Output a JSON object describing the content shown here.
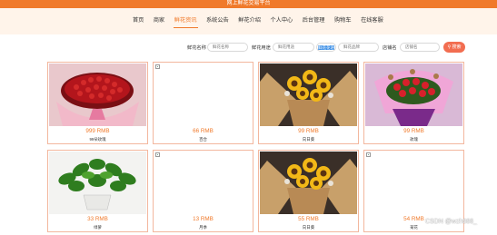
{
  "app": {
    "title": "网上鲜花交易平台"
  },
  "nav": {
    "items": [
      {
        "label": "首页"
      },
      {
        "label": "商家"
      },
      {
        "label": "鲜花资讯",
        "active": true
      },
      {
        "label": "系统公告"
      },
      {
        "label": "鲜花介绍"
      },
      {
        "label": "个人中心"
      },
      {
        "label": "后台管理"
      },
      {
        "label": "购物车"
      },
      {
        "label": "在线客服"
      }
    ]
  },
  "search": {
    "fields": [
      {
        "label": "鲜花名称",
        "placeholder": "鲜花名称"
      },
      {
        "label": "鲜花用途",
        "placeholder": "鲜花用途"
      },
      {
        "label": "",
        "value": "鲜花花语"
      },
      {
        "label": "",
        "placeholder": "鲜花品牌"
      },
      {
        "label": "店铺名",
        "placeholder": "店铺名"
      }
    ],
    "button_label": "搜索",
    "button_icon": "search-icon"
  },
  "products": [
    {
      "price": "999 RMB",
      "name": "99朵玫瑰",
      "image": "red-roses-bouquet"
    },
    {
      "price": "66 RMB",
      "name": "百合",
      "image": "broken-image"
    },
    {
      "price": "99 RMB",
      "name": "向日葵",
      "image": "sunflower-bouquet"
    },
    {
      "price": "99 RMB",
      "name": "玫瑰",
      "image": "pink-rose-bouquet"
    },
    {
      "price": "33 RMB",
      "name": "绿萝",
      "image": "green-potted-plant"
    },
    {
      "price": "13 RMB",
      "name": "月季",
      "image": "broken-image"
    },
    {
      "price": "55 RMB",
      "name": "向日葵",
      "image": "sunflower-bouquet"
    },
    {
      "price": "54 RMB",
      "name": "菊花",
      "image": "broken-image"
    }
  ],
  "watermark": "CSDN @wzh888_",
  "colors": {
    "accent": "#f07a2b",
    "button": "#f26d50",
    "card_border": "#f3b79e"
  }
}
